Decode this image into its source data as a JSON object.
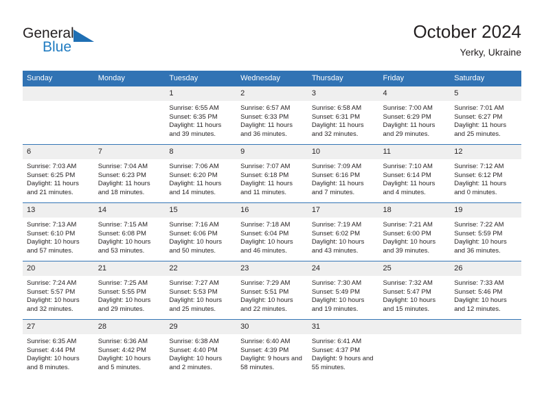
{
  "logo": {
    "word_one": "General",
    "word_two": "Blue",
    "mark_name": "triangle-flag-mark",
    "brand_blue": "#1f7bc1"
  },
  "header": {
    "title": "October 2024",
    "subtitle": "Yerky, Ukraine"
  },
  "colors": {
    "header_blue": "#3173b4",
    "daynum_gray": "#efefef",
    "text": "#231f20"
  },
  "calendar": {
    "weekday_headers": [
      "Sunday",
      "Monday",
      "Tuesday",
      "Wednesday",
      "Thursday",
      "Friday",
      "Saturday"
    ],
    "weeks": [
      [
        {
          "day": "",
          "sunrise": "",
          "sunset": "",
          "daylight": "",
          "empty": true
        },
        {
          "day": "",
          "sunrise": "",
          "sunset": "",
          "daylight": "",
          "empty": true
        },
        {
          "day": "1",
          "sunrise": "Sunrise: 6:55 AM",
          "sunset": "Sunset: 6:35 PM",
          "daylight": "Daylight: 11 hours and 39 minutes."
        },
        {
          "day": "2",
          "sunrise": "Sunrise: 6:57 AM",
          "sunset": "Sunset: 6:33 PM",
          "daylight": "Daylight: 11 hours and 36 minutes."
        },
        {
          "day": "3",
          "sunrise": "Sunrise: 6:58 AM",
          "sunset": "Sunset: 6:31 PM",
          "daylight": "Daylight: 11 hours and 32 minutes."
        },
        {
          "day": "4",
          "sunrise": "Sunrise: 7:00 AM",
          "sunset": "Sunset: 6:29 PM",
          "daylight": "Daylight: 11 hours and 29 minutes."
        },
        {
          "day": "5",
          "sunrise": "Sunrise: 7:01 AM",
          "sunset": "Sunset: 6:27 PM",
          "daylight": "Daylight: 11 hours and 25 minutes."
        }
      ],
      [
        {
          "day": "6",
          "sunrise": "Sunrise: 7:03 AM",
          "sunset": "Sunset: 6:25 PM",
          "daylight": "Daylight: 11 hours and 21 minutes."
        },
        {
          "day": "7",
          "sunrise": "Sunrise: 7:04 AM",
          "sunset": "Sunset: 6:23 PM",
          "daylight": "Daylight: 11 hours and 18 minutes."
        },
        {
          "day": "8",
          "sunrise": "Sunrise: 7:06 AM",
          "sunset": "Sunset: 6:20 PM",
          "daylight": "Daylight: 11 hours and 14 minutes."
        },
        {
          "day": "9",
          "sunrise": "Sunrise: 7:07 AM",
          "sunset": "Sunset: 6:18 PM",
          "daylight": "Daylight: 11 hours and 11 minutes."
        },
        {
          "day": "10",
          "sunrise": "Sunrise: 7:09 AM",
          "sunset": "Sunset: 6:16 PM",
          "daylight": "Daylight: 11 hours and 7 minutes."
        },
        {
          "day": "11",
          "sunrise": "Sunrise: 7:10 AM",
          "sunset": "Sunset: 6:14 PM",
          "daylight": "Daylight: 11 hours and 4 minutes."
        },
        {
          "day": "12",
          "sunrise": "Sunrise: 7:12 AM",
          "sunset": "Sunset: 6:12 PM",
          "daylight": "Daylight: 11 hours and 0 minutes."
        }
      ],
      [
        {
          "day": "13",
          "sunrise": "Sunrise: 7:13 AM",
          "sunset": "Sunset: 6:10 PM",
          "daylight": "Daylight: 10 hours and 57 minutes."
        },
        {
          "day": "14",
          "sunrise": "Sunrise: 7:15 AM",
          "sunset": "Sunset: 6:08 PM",
          "daylight": "Daylight: 10 hours and 53 minutes."
        },
        {
          "day": "15",
          "sunrise": "Sunrise: 7:16 AM",
          "sunset": "Sunset: 6:06 PM",
          "daylight": "Daylight: 10 hours and 50 minutes."
        },
        {
          "day": "16",
          "sunrise": "Sunrise: 7:18 AM",
          "sunset": "Sunset: 6:04 PM",
          "daylight": "Daylight: 10 hours and 46 minutes."
        },
        {
          "day": "17",
          "sunrise": "Sunrise: 7:19 AM",
          "sunset": "Sunset: 6:02 PM",
          "daylight": "Daylight: 10 hours and 43 minutes."
        },
        {
          "day": "18",
          "sunrise": "Sunrise: 7:21 AM",
          "sunset": "Sunset: 6:00 PM",
          "daylight": "Daylight: 10 hours and 39 minutes."
        },
        {
          "day": "19",
          "sunrise": "Sunrise: 7:22 AM",
          "sunset": "Sunset: 5:59 PM",
          "daylight": "Daylight: 10 hours and 36 minutes."
        }
      ],
      [
        {
          "day": "20",
          "sunrise": "Sunrise: 7:24 AM",
          "sunset": "Sunset: 5:57 PM",
          "daylight": "Daylight: 10 hours and 32 minutes."
        },
        {
          "day": "21",
          "sunrise": "Sunrise: 7:25 AM",
          "sunset": "Sunset: 5:55 PM",
          "daylight": "Daylight: 10 hours and 29 minutes."
        },
        {
          "day": "22",
          "sunrise": "Sunrise: 7:27 AM",
          "sunset": "Sunset: 5:53 PM",
          "daylight": "Daylight: 10 hours and 25 minutes."
        },
        {
          "day": "23",
          "sunrise": "Sunrise: 7:29 AM",
          "sunset": "Sunset: 5:51 PM",
          "daylight": "Daylight: 10 hours and 22 minutes."
        },
        {
          "day": "24",
          "sunrise": "Sunrise: 7:30 AM",
          "sunset": "Sunset: 5:49 PM",
          "daylight": "Daylight: 10 hours and 19 minutes."
        },
        {
          "day": "25",
          "sunrise": "Sunrise: 7:32 AM",
          "sunset": "Sunset: 5:47 PM",
          "daylight": "Daylight: 10 hours and 15 minutes."
        },
        {
          "day": "26",
          "sunrise": "Sunrise: 7:33 AM",
          "sunset": "Sunset: 5:46 PM",
          "daylight": "Daylight: 10 hours and 12 minutes."
        }
      ],
      [
        {
          "day": "27",
          "sunrise": "Sunrise: 6:35 AM",
          "sunset": "Sunset: 4:44 PM",
          "daylight": "Daylight: 10 hours and 8 minutes."
        },
        {
          "day": "28",
          "sunrise": "Sunrise: 6:36 AM",
          "sunset": "Sunset: 4:42 PM",
          "daylight": "Daylight: 10 hours and 5 minutes."
        },
        {
          "day": "29",
          "sunrise": "Sunrise: 6:38 AM",
          "sunset": "Sunset: 4:40 PM",
          "daylight": "Daylight: 10 hours and 2 minutes."
        },
        {
          "day": "30",
          "sunrise": "Sunrise: 6:40 AM",
          "sunset": "Sunset: 4:39 PM",
          "daylight": "Daylight: 9 hours and 58 minutes."
        },
        {
          "day": "31",
          "sunrise": "Sunrise: 6:41 AM",
          "sunset": "Sunset: 4:37 PM",
          "daylight": "Daylight: 9 hours and 55 minutes."
        },
        {
          "day": "",
          "sunrise": "",
          "sunset": "",
          "daylight": "",
          "empty": true
        },
        {
          "day": "",
          "sunrise": "",
          "sunset": "",
          "daylight": "",
          "empty": true
        }
      ]
    ]
  }
}
